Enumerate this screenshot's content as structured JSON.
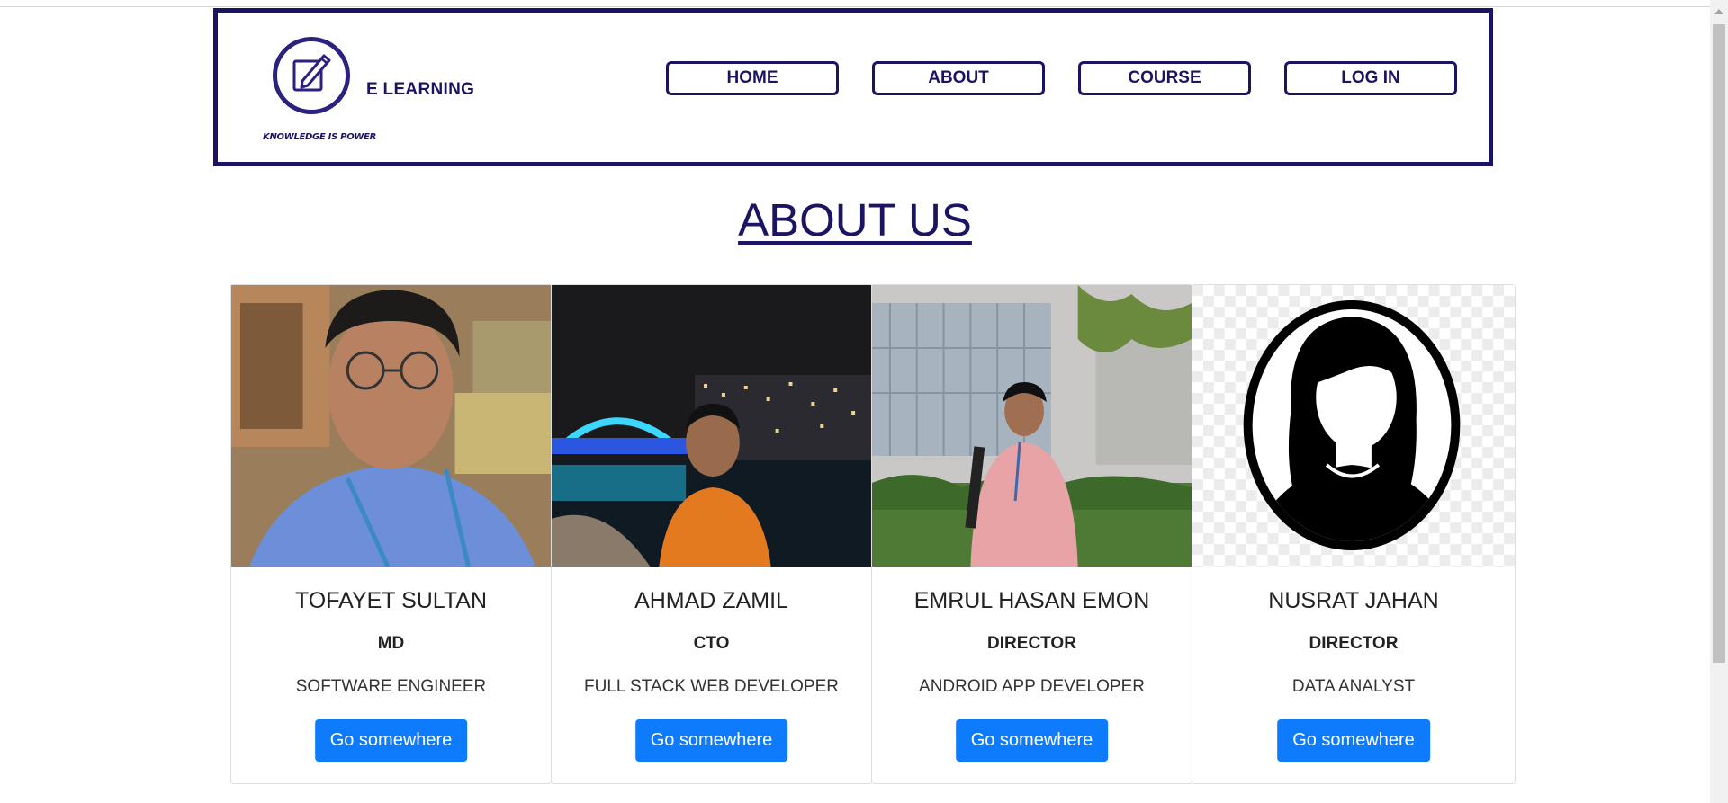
{
  "header": {
    "brand": "E LEARNING",
    "logo_tagline": "KNOWLEDGE IS POWER",
    "nav": [
      {
        "label": "HOME"
      },
      {
        "label": "ABOUT"
      },
      {
        "label": "COURSE"
      },
      {
        "label": "LOG IN"
      }
    ]
  },
  "main": {
    "title": "ABOUT US",
    "team": [
      {
        "name": "TOFAYET SULTAN",
        "role": "MD",
        "title": "SOFTWARE ENGINEER",
        "button": "Go somewhere"
      },
      {
        "name": "AHMAD ZAMIL",
        "role": "CTO",
        "title": "FULL STACK WEB DEVELOPER",
        "button": "Go somewhere"
      },
      {
        "name": "EMRUL HASAN EMON",
        "role": "DIRECTOR",
        "title": "ANDROID APP DEVELOPER",
        "button": "Go somewhere"
      },
      {
        "name": "NUSRAT JAHAN",
        "role": "DIRECTOR",
        "title": "DATA ANALYST",
        "button": "Go somewhere"
      }
    ]
  },
  "colors": {
    "brand_navy": "#1b1462",
    "button_blue": "#0d7bfb"
  }
}
